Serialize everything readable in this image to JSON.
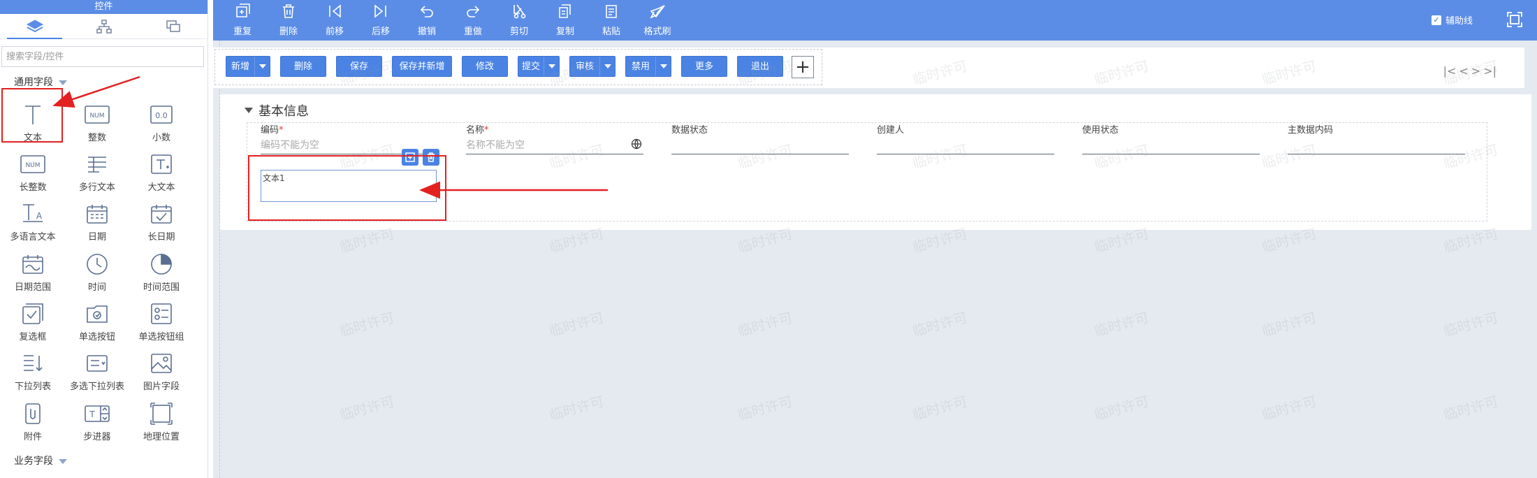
{
  "left_panel": {
    "title": "控件",
    "search_placeholder": "搜索字段/控件",
    "section_common": "通用字段",
    "section_business": "业务字段",
    "controls": [
      {
        "label": "文本",
        "icon": "text-icon"
      },
      {
        "label": "整数",
        "icon": "num-icon",
        "badge": "NUM"
      },
      {
        "label": "小数",
        "icon": "decimal-icon",
        "badge": "0.0"
      },
      {
        "label": "长整数",
        "icon": "long-num-icon",
        "badge": "NUM"
      },
      {
        "label": "多行文本",
        "icon": "multiline-icon"
      },
      {
        "label": "大文本",
        "icon": "bigtext-icon"
      },
      {
        "label": "多语言文本",
        "icon": "multilang-icon"
      },
      {
        "label": "日期",
        "icon": "date-icon"
      },
      {
        "label": "长日期",
        "icon": "longdate-icon"
      },
      {
        "label": "日期范围",
        "icon": "daterange-icon"
      },
      {
        "label": "时间",
        "icon": "time-icon"
      },
      {
        "label": "时间范围",
        "icon": "timerange-icon"
      },
      {
        "label": "复选框",
        "icon": "checkbox-icon"
      },
      {
        "label": "单选按钮",
        "icon": "radio-icon"
      },
      {
        "label": "单选按钮组",
        "icon": "radiogroup-icon"
      },
      {
        "label": "下拉列表",
        "icon": "dropdown-icon"
      },
      {
        "label": "多选下拉列表",
        "icon": "multidropdown-icon"
      },
      {
        "label": "图片字段",
        "icon": "image-icon"
      },
      {
        "label": "附件",
        "icon": "attachment-icon"
      },
      {
        "label": "步进器",
        "icon": "stepper-icon"
      },
      {
        "label": "地理位置",
        "icon": "location-icon"
      }
    ]
  },
  "toolbar": {
    "items": [
      {
        "label": "重复",
        "icon": "redo-icon"
      },
      {
        "label": "删除",
        "icon": "delete-icon"
      },
      {
        "label": "前移",
        "icon": "move-forward-icon"
      },
      {
        "label": "后移",
        "icon": "move-back-icon"
      },
      {
        "label": "撤销",
        "icon": "undo-icon"
      },
      {
        "label": "重做",
        "icon": "redo-arrow-icon"
      },
      {
        "label": "剪切",
        "icon": "cut-icon"
      },
      {
        "label": "复制",
        "icon": "copy-icon"
      },
      {
        "label": "粘贴",
        "icon": "paste-icon"
      },
      {
        "label": "格式刷",
        "icon": "format-brush-icon"
      }
    ],
    "aux_label": "辅助线",
    "aux_checked": true
  },
  "action_bar": {
    "buttons": [
      "新增",
      "删除",
      "保存",
      "保存并新增",
      "修改",
      "提交",
      "审核",
      "禁用",
      "更多",
      "退出"
    ],
    "pager": [
      "|<",
      "<",
      ">",
      ">|"
    ]
  },
  "form": {
    "section_title": "基本信息",
    "fields": [
      {
        "label": "编码",
        "required": true,
        "placeholder": "编码不能为空"
      },
      {
        "label": "名称",
        "required": true,
        "placeholder": "名称不能为空"
      },
      {
        "label": "数据状态",
        "required": false,
        "placeholder": ""
      },
      {
        "label": "创建人",
        "required": false,
        "placeholder": ""
      },
      {
        "label": "使用状态",
        "required": false,
        "placeholder": ""
      },
      {
        "label": "主数据内码",
        "required": false,
        "placeholder": ""
      }
    ],
    "new_field_label": "文本1",
    "required_mark": "*"
  },
  "watermark": "临时许可",
  "colors": {
    "accent": "#5b8de6",
    "button": "#4a83e4",
    "canvas": "#e5eaf1",
    "annotation": "#e32020"
  }
}
